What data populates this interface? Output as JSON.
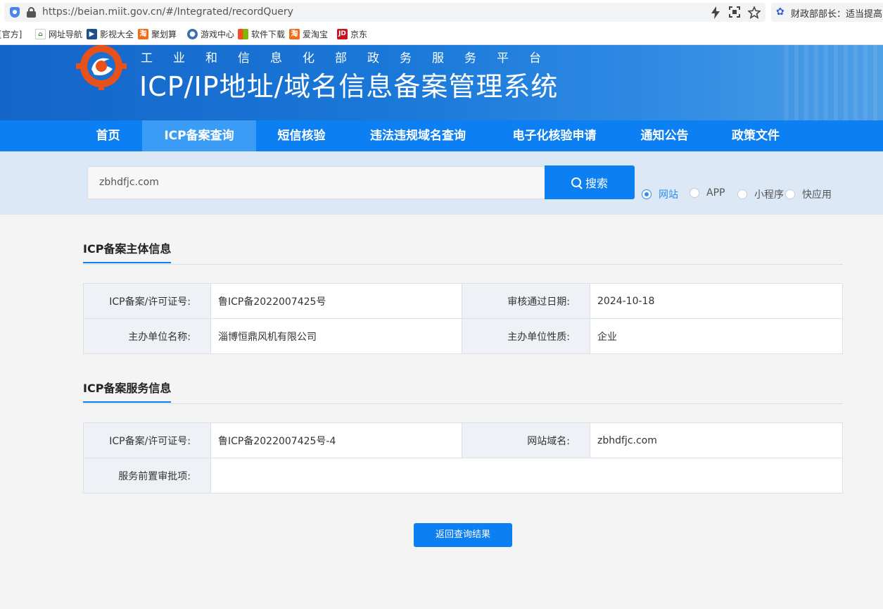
{
  "browser": {
    "url": "https://beian.miit.gov.cn/#/Integrated/recordQuery",
    "extension_text": "财政部部长：适当提高",
    "bookmarks": [
      {
        "label": "[官方]",
        "icon": "bookmark-icon"
      },
      {
        "label": "网址导航",
        "icon": "2345-icon"
      },
      {
        "label": "影视大全",
        "icon": "film-icon"
      },
      {
        "label": "聚划算",
        "icon": "taobao-icon"
      },
      {
        "label": "游戏中心",
        "icon": "game-icon"
      },
      {
        "label": "软件下载",
        "icon": "windows-icon"
      },
      {
        "label": "爱淘宝",
        "icon": "taobao-icon"
      },
      {
        "label": "京东",
        "icon": "jd-icon"
      }
    ]
  },
  "banner": {
    "subtitle": "工业和信息化部政务服务平台",
    "title": "ICP/IP地址/域名信息备案管理系统"
  },
  "nav": {
    "items": [
      {
        "label": "首页"
      },
      {
        "label": "ICP备案查询"
      },
      {
        "label": "短信核验"
      },
      {
        "label": "违法违规域名查询"
      },
      {
        "label": "电子化核验申请"
      },
      {
        "label": "通知公告"
      },
      {
        "label": "政策文件"
      }
    ],
    "active": "ICP备案查询"
  },
  "search": {
    "value": "zbhdfjc.com",
    "button_label": "搜索",
    "types": [
      {
        "label": "网站",
        "checked": true
      },
      {
        "label": "APP",
        "checked": false
      },
      {
        "label": "小程序",
        "checked": false
      },
      {
        "label": "快应用",
        "checked": false
      }
    ]
  },
  "subject": {
    "title": "ICP备案主体信息",
    "license_label": "ICP备案/许可证号:",
    "license_value": "鲁ICP备2022007425号",
    "date_label": "审核通过日期:",
    "date_value": "2024-10-18",
    "org_label": "主办单位名称:",
    "org_value": "淄博恒鼎风机有限公司",
    "nature_label": "主办单位性质:",
    "nature_value": "企业"
  },
  "service": {
    "title": "ICP备案服务信息",
    "license_label": "ICP备案/许可证号:",
    "license_value": "鲁ICP备2022007425号-4",
    "domain_label": "网站域名:",
    "domain_value": "zbhdfjc.com",
    "approval_label": "服务前置审批项:",
    "approval_value": ""
  },
  "back_button": "返回查询结果",
  "colors": {
    "primary": "#0c7ff2",
    "nav_active": "#3a9cf5",
    "search_strip": "#dce8f5"
  }
}
